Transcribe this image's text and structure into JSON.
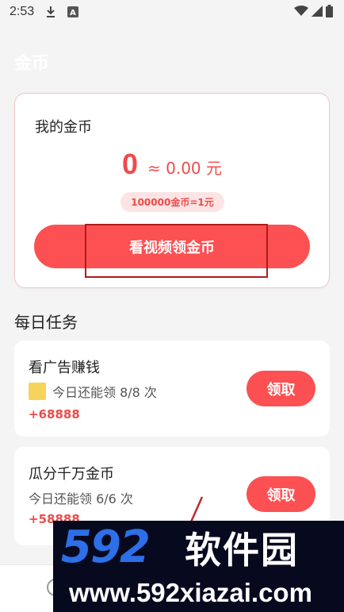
{
  "status_bar": {
    "time": "2:53",
    "icons": [
      "download-icon",
      "font-icon",
      "wifi-icon",
      "signal-icon",
      "battery-icon"
    ]
  },
  "page": {
    "title": "金币"
  },
  "coin_card": {
    "title": "我的金币",
    "coin_count": "0",
    "coin_value": "≈ 0.00 元",
    "rate": "100000金币=1元",
    "button_label": "看视频领金币"
  },
  "daily_tasks": {
    "section_title": "每日任务",
    "tasks": [
      {
        "title": "看广告赚钱",
        "remaining": "今日还能领 8/8 次",
        "reward": "+68888",
        "button_label": "领取"
      },
      {
        "title": "瓜分千万金币",
        "remaining": "今日还能领 6/6 次",
        "reward": "+58888",
        "button_label": "领取"
      }
    ]
  },
  "watermark": {
    "logo_number": "592",
    "logo_text": "软件园",
    "url": "www.592xiazai.com"
  },
  "colors": {
    "accent": "#fc5053",
    "accent_text": "#ee4b4b",
    "badge_bg": "#fde4e4",
    "background": "#f4f4f4",
    "watermark_bg": "#070a1f",
    "watermark_blue": "#2d6fe8"
  }
}
